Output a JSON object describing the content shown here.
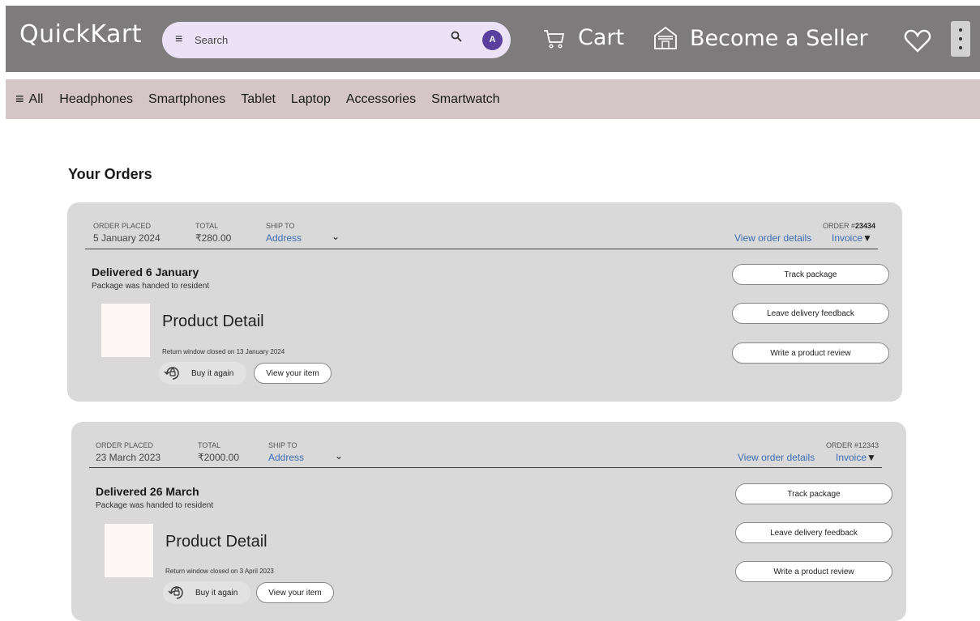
{
  "header": {
    "logo": "QuickKart",
    "search_placeholder": "Search",
    "avatar_letter": "A",
    "cart_label": "Cart",
    "seller_label": "Become a Seller"
  },
  "categories": {
    "all_label": "All",
    "items": [
      "Headphones",
      "Smartphones",
      "Tablet",
      "Laptop",
      "Accessories",
      "Smartwatch"
    ]
  },
  "page_title": "Your Orders",
  "orders": [
    {
      "placed_label": "ORDER PLACED",
      "placed_value": "5 January 2024",
      "total_label": "TOTAL",
      "total_value": "₹280.00",
      "shipto_label": "SHIP TO",
      "shipto_value": "Address",
      "order_prefix": "ORDER #",
      "order_number": "23434",
      "view_details": "View order details",
      "invoice": "Invoice",
      "status": "Delivered 6 January",
      "substatus": "Package was handed to resident",
      "product_title": "Product Detail",
      "return_note": "Return window closed on 13 January 2024",
      "buy_again": "Buy it again",
      "view_item": "View your item",
      "actions": [
        "Track package",
        "Leave delivery feedback",
        "Write a product review"
      ]
    },
    {
      "placed_label": "ORDER PLACED",
      "placed_value": "23 March 2023",
      "total_label": "TOTAL",
      "total_value": "₹2000.00",
      "shipto_label": "SHIP TO",
      "shipto_value": "Address",
      "order_prefix": "ORDER #",
      "order_number": "12343",
      "view_details": "View order details",
      "invoice": "Invoice",
      "status": "Delivered 26 March",
      "substatus": "Package was handed to resident",
      "product_title": "Product Detail",
      "return_note": "Return window closed on 3 April 2023",
      "buy_again": "Buy it again",
      "view_item": "View your item",
      "actions": [
        "Track package",
        "Leave delivery feedback",
        "Write a product review"
      ]
    }
  ],
  "colors": {
    "topbar": "#7d7b7b",
    "catbar": "#d4c6c6",
    "card": "#d9d9d9",
    "link": "#3d6db3",
    "avatar": "#5b3f9e",
    "search_bg": "#ebe3f5"
  },
  "icons": [
    "menu-icon",
    "search-icon",
    "cart-icon",
    "store-icon",
    "heart-icon",
    "more-vertical-icon",
    "chevron-down-icon",
    "reorder-icon"
  ]
}
